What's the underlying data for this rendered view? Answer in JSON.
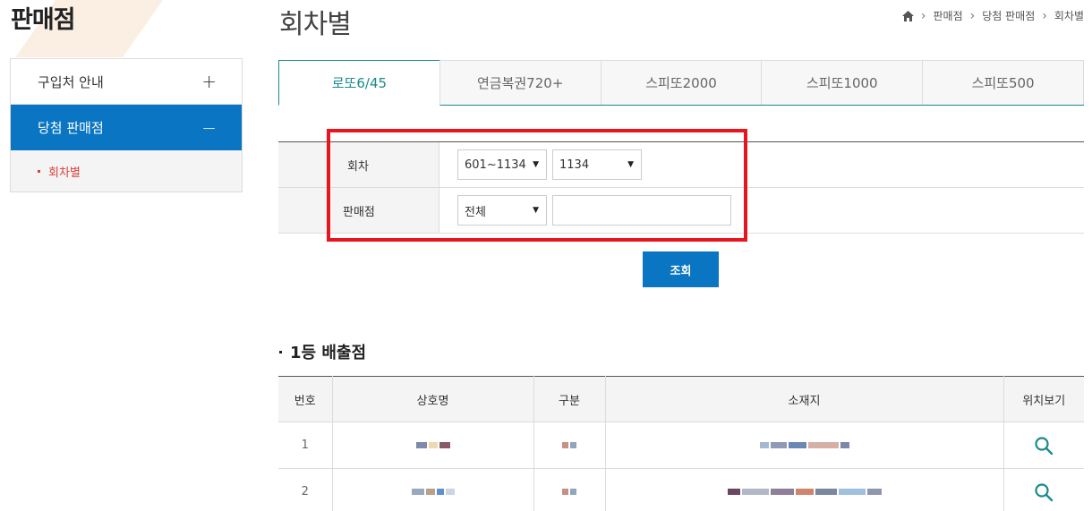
{
  "sidebar": {
    "title": "판매점",
    "items": [
      {
        "label": "구입처 안내",
        "sign": "+"
      },
      {
        "label": "당첨 판매점",
        "sign": "−"
      }
    ],
    "sub_items": [
      {
        "label": "회차별"
      }
    ]
  },
  "header": {
    "title": "회차별",
    "breadcrumb": [
      "판매점",
      "당첨 판매점",
      "회차별"
    ]
  },
  "tabs": [
    {
      "label": "로또6/45",
      "active": true
    },
    {
      "label": "연금복권720+"
    },
    {
      "label": "스피또2000"
    },
    {
      "label": "스피또1000"
    },
    {
      "label": "스피또500"
    }
  ],
  "search": {
    "round_label": "회차",
    "round_range": "601~1134",
    "round_value": "1134",
    "store_label": "판매점",
    "store_region": "전체",
    "store_text": "",
    "button_label": "조회"
  },
  "results": {
    "section_title": "1등 배출점",
    "columns": [
      "번호",
      "상호명",
      "구분",
      "소재지",
      "위치보기"
    ],
    "rows": [
      {
        "no": "1"
      },
      {
        "no": "2"
      }
    ]
  },
  "colors": {
    "primary_blue": "#0a75c2",
    "teal_active": "#1a8a8a",
    "highlight_red": "#e5161e",
    "sub_item_red": "#d8413a"
  }
}
